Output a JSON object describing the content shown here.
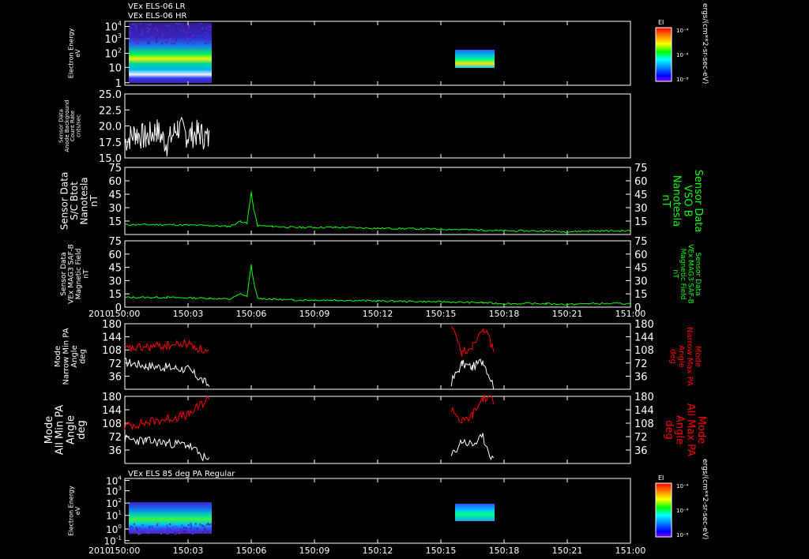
{
  "header": {
    "line1": "VEx ELS-06 LR",
    "line2": "VEx ELS-06 HR",
    "bottom_title": "VEx ELS 85 deg PA Regular"
  },
  "colorbar": {
    "label": "EI",
    "units": "ergs/(cm**2-sr-sec-eV)",
    "tick_top": "10⁻⁴",
    "tick_mid": "10⁻⁶",
    "tick_bottom": "10⁻⁸",
    "colors": [
      "#ff0000",
      "#ff8000",
      "#ffff00",
      "#00ff00",
      "#00ffff",
      "#0080ff",
      "#0000ff",
      "#8000ff"
    ]
  },
  "time_axis": {
    "year": "2010",
    "ticks": [
      "150:00",
      "150:03",
      "150:06",
      "150:09",
      "150:12",
      "150:15",
      "150:18",
      "150:21",
      "151:00"
    ]
  },
  "colors": {
    "white": "#ffffff",
    "green": "#00ff00",
    "red": "#ff0000"
  },
  "panels": {
    "spec1": {
      "ylabel": [
        "Electron Energy",
        "eV"
      ],
      "yticks": [
        {
          "t": "10",
          "sup": "4"
        },
        {
          "t": "10",
          "sup": "3"
        },
        {
          "t": "10",
          "sup": "2"
        },
        {
          "t": "10",
          "sup": ""
        },
        {
          "t": "1",
          "sup": ""
        }
      ]
    },
    "bg": {
      "ylabel": [
        "Sensor Data",
        "Anode Background",
        "Count Rate",
        "cnts/sec"
      ],
      "yticks": [
        "25.0",
        "22.5",
        "20.0",
        "17.5",
        "15.0"
      ]
    },
    "btot": {
      "ylabel": [
        "Sensor Data",
        "S/C Btot",
        "Nanotesla",
        "nT"
      ],
      "rlabel": [
        "Sensor Data",
        "VSO B",
        "Nanotesla",
        "nT"
      ],
      "yticks": [
        "75",
        "60",
        "45",
        "30",
        "15"
      ]
    },
    "mag": {
      "ylabel": [
        "Sensor Data",
        "VEx MAG3 SAF-B",
        "Magnetic Field",
        "nT"
      ],
      "rlabel": [
        "Sensor Data",
        "VEx MAG3 SAF-B",
        "Magnetic Field",
        "nT"
      ],
      "yticks": [
        "75",
        "60",
        "45",
        "30",
        "15",
        "0"
      ]
    },
    "narrow": {
      "ylabel": [
        "Mode",
        "Narrow Min PA",
        "Angle",
        "deg"
      ],
      "rlabel": [
        "Mode",
        "Narrow Max PA",
        "Angle",
        "deg"
      ],
      "yticks": [
        "180",
        "144",
        "108",
        "72",
        "36"
      ]
    },
    "all": {
      "ylabel": [
        "Mode",
        "All Min PA",
        "Angle",
        "deg"
      ],
      "rlabel": [
        "Mode",
        "All Max PA",
        "Angle",
        "deg"
      ],
      "yticks": [
        "180",
        "144",
        "108",
        "72",
        "36"
      ]
    },
    "spec2": {
      "ylabel": [
        "Electron Energy",
        "eV"
      ],
      "yticks": [
        {
          "t": "10",
          "sup": "4"
        },
        {
          "t": "10",
          "sup": "3"
        },
        {
          "t": "10",
          "sup": "2"
        },
        {
          "t": "10",
          "sup": "1"
        },
        {
          "t": "10",
          "sup": "0"
        },
        {
          "t": "10",
          "sup": "-1"
        }
      ]
    }
  },
  "chart_data": [
    {
      "type": "heatmap",
      "title": "VEx ELS-06 LR / VEx ELS-06 HR",
      "ylabel": "Electron Energy eV",
      "yscale": "log",
      "xlim": [
        "150:00",
        "151:00"
      ],
      "data_intervals": [
        [
          "150:00",
          "150:04"
        ],
        [
          "150:15.5",
          "150:17.5"
        ]
      ],
      "colorbar_label": "EI ergs/(cm**2-sr-sec-eV)",
      "clim": [
        1e-08,
        0.0001
      ]
    },
    {
      "type": "line",
      "ylabel": "Sensor Data Anode Background Count Rate cnts/sec",
      "ylim": [
        13.5,
        25.0
      ],
      "series": [
        {
          "color": "#ffffff",
          "x_minutes": [
            0,
            0.5,
            1,
            1.5,
            2,
            2.5,
            3,
            3.5,
            4
          ],
          "values": [
            16.5,
            18.0,
            17.0,
            18.5,
            16.0,
            19.0,
            17.5,
            18.0,
            16.8
          ]
        }
      ]
    },
    {
      "type": "line",
      "ylabel": "Sensor Data S/C Btot Nanotesla nT",
      "ylim": [
        0,
        75
      ],
      "series": [
        {
          "color": "#00ff00",
          "x_minutes": [
            0,
            2,
            4,
            5,
            5.5,
            5.8,
            6,
            6.1,
            6.3,
            7,
            8,
            9,
            10,
            12,
            15,
            17,
            18,
            20,
            21,
            22,
            24
          ],
          "values": [
            11,
            11,
            10,
            9,
            15,
            12,
            48,
            30,
            10,
            9,
            8,
            8,
            8,
            7,
            6,
            5,
            4,
            4,
            3,
            4,
            4
          ]
        }
      ]
    },
    {
      "type": "line",
      "ylabel": "Sensor Data VEx MAG3 SAF-B Magnetic Field nT",
      "ylim": [
        0,
        75
      ],
      "series": [
        {
          "color": "#00ff00",
          "x_minutes": [
            0,
            2,
            4,
            5,
            5.5,
            5.8,
            6,
            6.1,
            6.3,
            7,
            8,
            9,
            10,
            12,
            15,
            17,
            18,
            20,
            21,
            22,
            24
          ],
          "values": [
            11,
            11,
            10,
            9,
            15,
            12,
            48,
            30,
            10,
            9,
            8,
            8,
            8,
            7,
            6,
            5,
            4,
            4,
            3,
            4,
            4
          ]
        }
      ]
    },
    {
      "type": "line",
      "ylabel": "Mode Narrow Min PA Angle deg",
      "ylim": [
        0,
        180
      ],
      "series": [
        {
          "name": "Narrow Min PA",
          "color": "#ffffff",
          "x_minutes": [
            0,
            1,
            2,
            3,
            4,
            15.5,
            16,
            16.5,
            17,
            17.5
          ],
          "values": [
            75,
            65,
            60,
            55,
            10,
            20,
            70,
            60,
            80,
            10
          ]
        },
        {
          "name": "Narrow Max PA",
          "color": "#ff0000",
          "x_minutes": [
            0,
            1,
            2,
            3,
            4,
            15.5,
            16,
            16.5,
            17,
            17.5
          ],
          "values": [
            110,
            115,
            120,
            125,
            100,
            170,
            100,
            120,
            175,
            110
          ]
        }
      ]
    },
    {
      "type": "line",
      "ylabel": "Mode All Min PA Angle deg",
      "ylim": [
        0,
        180
      ],
      "series": [
        {
          "name": "All Min PA",
          "color": "#ffffff",
          "x_minutes": [
            0,
            1,
            2,
            3,
            4,
            15.5,
            16,
            16.5,
            17,
            17.5
          ],
          "values": [
            65,
            60,
            55,
            50,
            5,
            20,
            60,
            50,
            70,
            5
          ]
        },
        {
          "name": "All Max PA",
          "color": "#ff0000",
          "x_minutes": [
            0,
            1,
            2,
            3,
            4,
            15.5,
            16,
            16.5,
            17,
            17.5
          ],
          "values": [
            100,
            110,
            120,
            130,
            175,
            150,
            110,
            130,
            175,
            170
          ]
        }
      ]
    },
    {
      "type": "heatmap",
      "title": "VEx ELS 85 deg PA Regular",
      "ylabel": "Electron Energy eV",
      "yscale": "log",
      "xlim": [
        "150:00",
        "151:00"
      ],
      "data_intervals": [
        [
          "150:00",
          "150:04"
        ],
        [
          "150:15.5",
          "150:17.5"
        ]
      ],
      "colorbar_label": "EI ergs/(cm**2-sr-sec-eV)",
      "clim": [
        1e-08,
        0.0001
      ]
    }
  ]
}
